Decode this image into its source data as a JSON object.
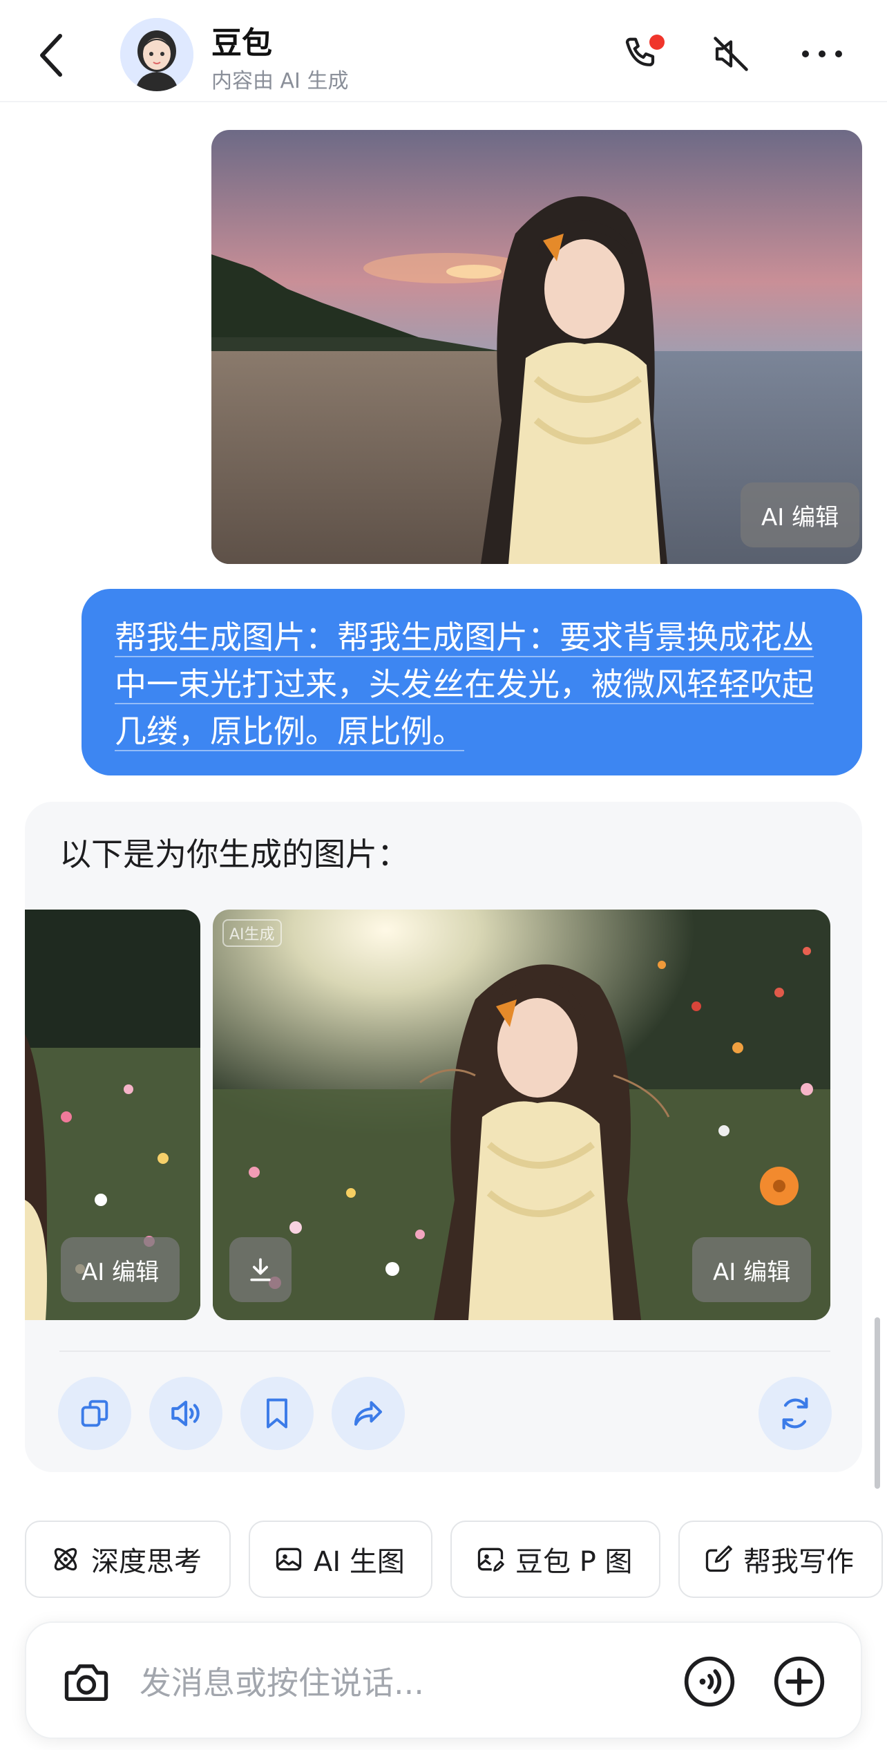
{
  "header": {
    "bot_name": "豆包",
    "bot_subtitle": "内容由 AI 生成",
    "icons": [
      "back-icon",
      "phone-icon",
      "speaker-off-icon",
      "more-icon"
    ]
  },
  "sent_image": {
    "edit_label": "AI 编辑"
  },
  "sent_message": {
    "text": "帮我生成图片：帮我生成图片：要求背景换成花丛中一束光打过来，头发丝在发光，被微风轻轻吹起几缕，原比例。原比例。"
  },
  "response": {
    "text": "以下是为你生成的图片：",
    "images": [
      {
        "edit_label": "AI 编辑"
      },
      {
        "watermark": "AI生成",
        "edit_label": "AI 编辑"
      }
    ],
    "actions": [
      "copy-icon",
      "speaker-icon",
      "bookmark-icon",
      "share-icon",
      "regenerate-icon"
    ]
  },
  "quick_actions": [
    {
      "label": "深度思考",
      "icon": "atom-icon"
    },
    {
      "label": "AI 生图",
      "icon": "image-icon"
    },
    {
      "label": "豆包 P 图",
      "icon": "image-edit-icon"
    },
    {
      "label": "帮我写作",
      "icon": "pen-square-icon"
    }
  ],
  "input": {
    "placeholder": "发消息或按住说话..."
  },
  "colors": {
    "accent": "#3d86f2",
    "icon_blue": "#3b7be8",
    "card_bg": "#f6f7f9",
    "notification_red": "#f0352b"
  }
}
